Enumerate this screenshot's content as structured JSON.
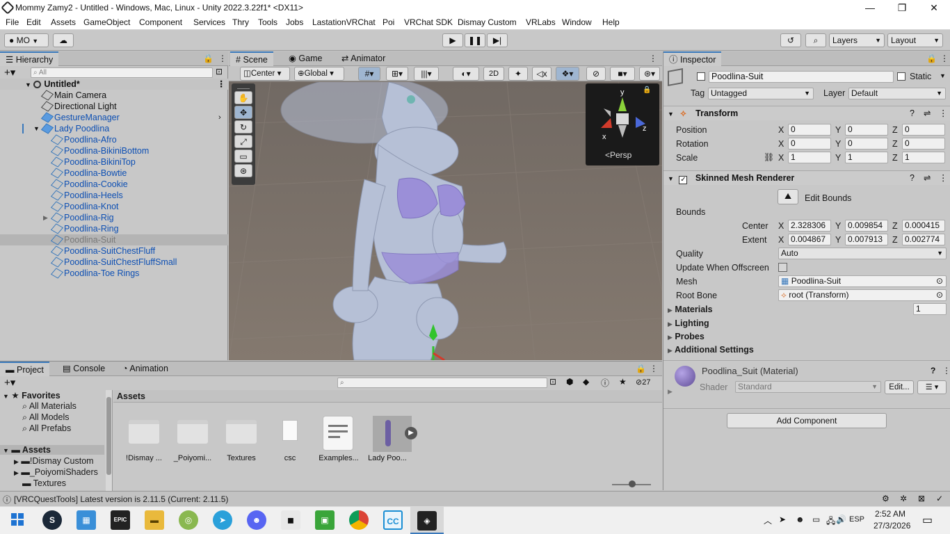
{
  "window": {
    "title": "Mommy Zamy2 - Untitled - Windows, Mac, Linux - Unity 2022.3.22f1* <DX11>",
    "min": "—",
    "max": "❐",
    "close": "✕"
  },
  "menu": [
    "File",
    "Edit",
    "Assets",
    "GameObject",
    "Component",
    "Services",
    "Thry",
    "Tools",
    "Jobs",
    "LastationVRChat",
    "Poi",
    "VRChat SDK",
    "Dismay Custom",
    "VRLabs",
    "Window",
    "Help"
  ],
  "toolbar": {
    "account": "MO",
    "layers": "Layers",
    "layout": "Layout"
  },
  "hierarchy": {
    "tab": "Hierarchy",
    "search_placeholder": "All",
    "scene": "Untitled*",
    "items": [
      "Main Camera",
      "Directional Light",
      "GestureManager",
      "Lady Poodlina",
      "Poodlina-Afro",
      "Poodlina-BikiniBottom",
      "Poodlina-BikiniTop",
      "Poodlina-Bowtie",
      "Poodlina-Cookie",
      "Poodlina-Heels",
      "Poodlina-Knot",
      "Poodlina-Rig",
      "Poodlina-Ring",
      "Poodlina-Suit",
      "Poodlina-SuitChestFluff",
      "Poodlina-SuitChestFluffSmall",
      "Poodlina-Toe Rings"
    ]
  },
  "scene": {
    "tabs": [
      "Scene",
      "Game",
      "Animator"
    ],
    "pivot": "Center",
    "space": "Global",
    "mode2d": "2D",
    "persp": "<Persp",
    "gizmo_axes": {
      "y": "y",
      "x": "x",
      "z": "z"
    }
  },
  "inspector": {
    "tab": "Inspector",
    "object_name": "Poodlina-Suit",
    "static": "Static",
    "tag_label": "Tag",
    "tag": "Untagged",
    "layer_label": "Layer",
    "layer": "Default",
    "transform": {
      "title": "Transform",
      "position": {
        "label": "Position",
        "x": "0",
        "y": "0",
        "z": "0"
      },
      "rotation": {
        "label": "Rotation",
        "x": "0",
        "y": "0",
        "z": "0"
      },
      "scale": {
        "label": "Scale",
        "x": "1",
        "y": "1",
        "z": "1"
      }
    },
    "smr": {
      "title": "Skinned Mesh Renderer",
      "edit_bounds": "Edit Bounds",
      "bounds": "Bounds",
      "center": {
        "label": "Center",
        "x": "2.328306",
        "y": "0.009854",
        "z": "0.000415"
      },
      "extent": {
        "label": "Extent",
        "x": "0.004867",
        "y": "0.007913",
        "z": "0.002774"
      },
      "quality_label": "Quality",
      "quality": "Auto",
      "update_offscreen": "Update When Offscreen",
      "mesh_label": "Mesh",
      "mesh": "Poodlina-Suit",
      "root_bone_label": "Root Bone",
      "root_bone": "root (Transform)",
      "materials": "Materials",
      "materials_count": "1",
      "lighting": "Lighting",
      "probes": "Probes",
      "additional": "Additional Settings"
    },
    "material": {
      "name": "Poodlina_Suit (Material)",
      "shader_label": "Shader",
      "shader": "Standard",
      "edit": "Edit..."
    },
    "add_component": "Add Component"
  },
  "project": {
    "tabs": [
      "Project",
      "Console",
      "Animation"
    ],
    "favorites": "Favorites",
    "fav_items": [
      "All Materials",
      "All Models",
      "All Prefabs"
    ],
    "assets_root": "Assets",
    "tree": [
      "!Dismay Custom",
      "_PoiyomiShaders",
      "Textures"
    ],
    "breadcrumb": "Assets",
    "hidden_count": "27",
    "assets": [
      "!Dismay ...",
      "_Poiyomi...",
      "Textures",
      "csc",
      "Examples...",
      "Lady Poo..."
    ]
  },
  "status": {
    "message": "[VRCQuestTools] Latest version is 2.11.5 (Current: 2.11.5)"
  },
  "taskbar": {
    "lang": "ESP",
    "time": "2:52 AM",
    "date": "27/3/2026",
    "apps": [
      "Steam",
      "Store",
      "Epic",
      "Explorer",
      "Blender",
      "Telegram",
      "Discord",
      "Roblox",
      "Minecraft",
      "Chrome",
      "ClipStudio",
      "Unity"
    ]
  },
  "colors": {
    "accent": "#3a79bb",
    "link_blue": "#0d4fb3",
    "scene_bg": "#7d756f",
    "selection": "#b4b4b4"
  }
}
